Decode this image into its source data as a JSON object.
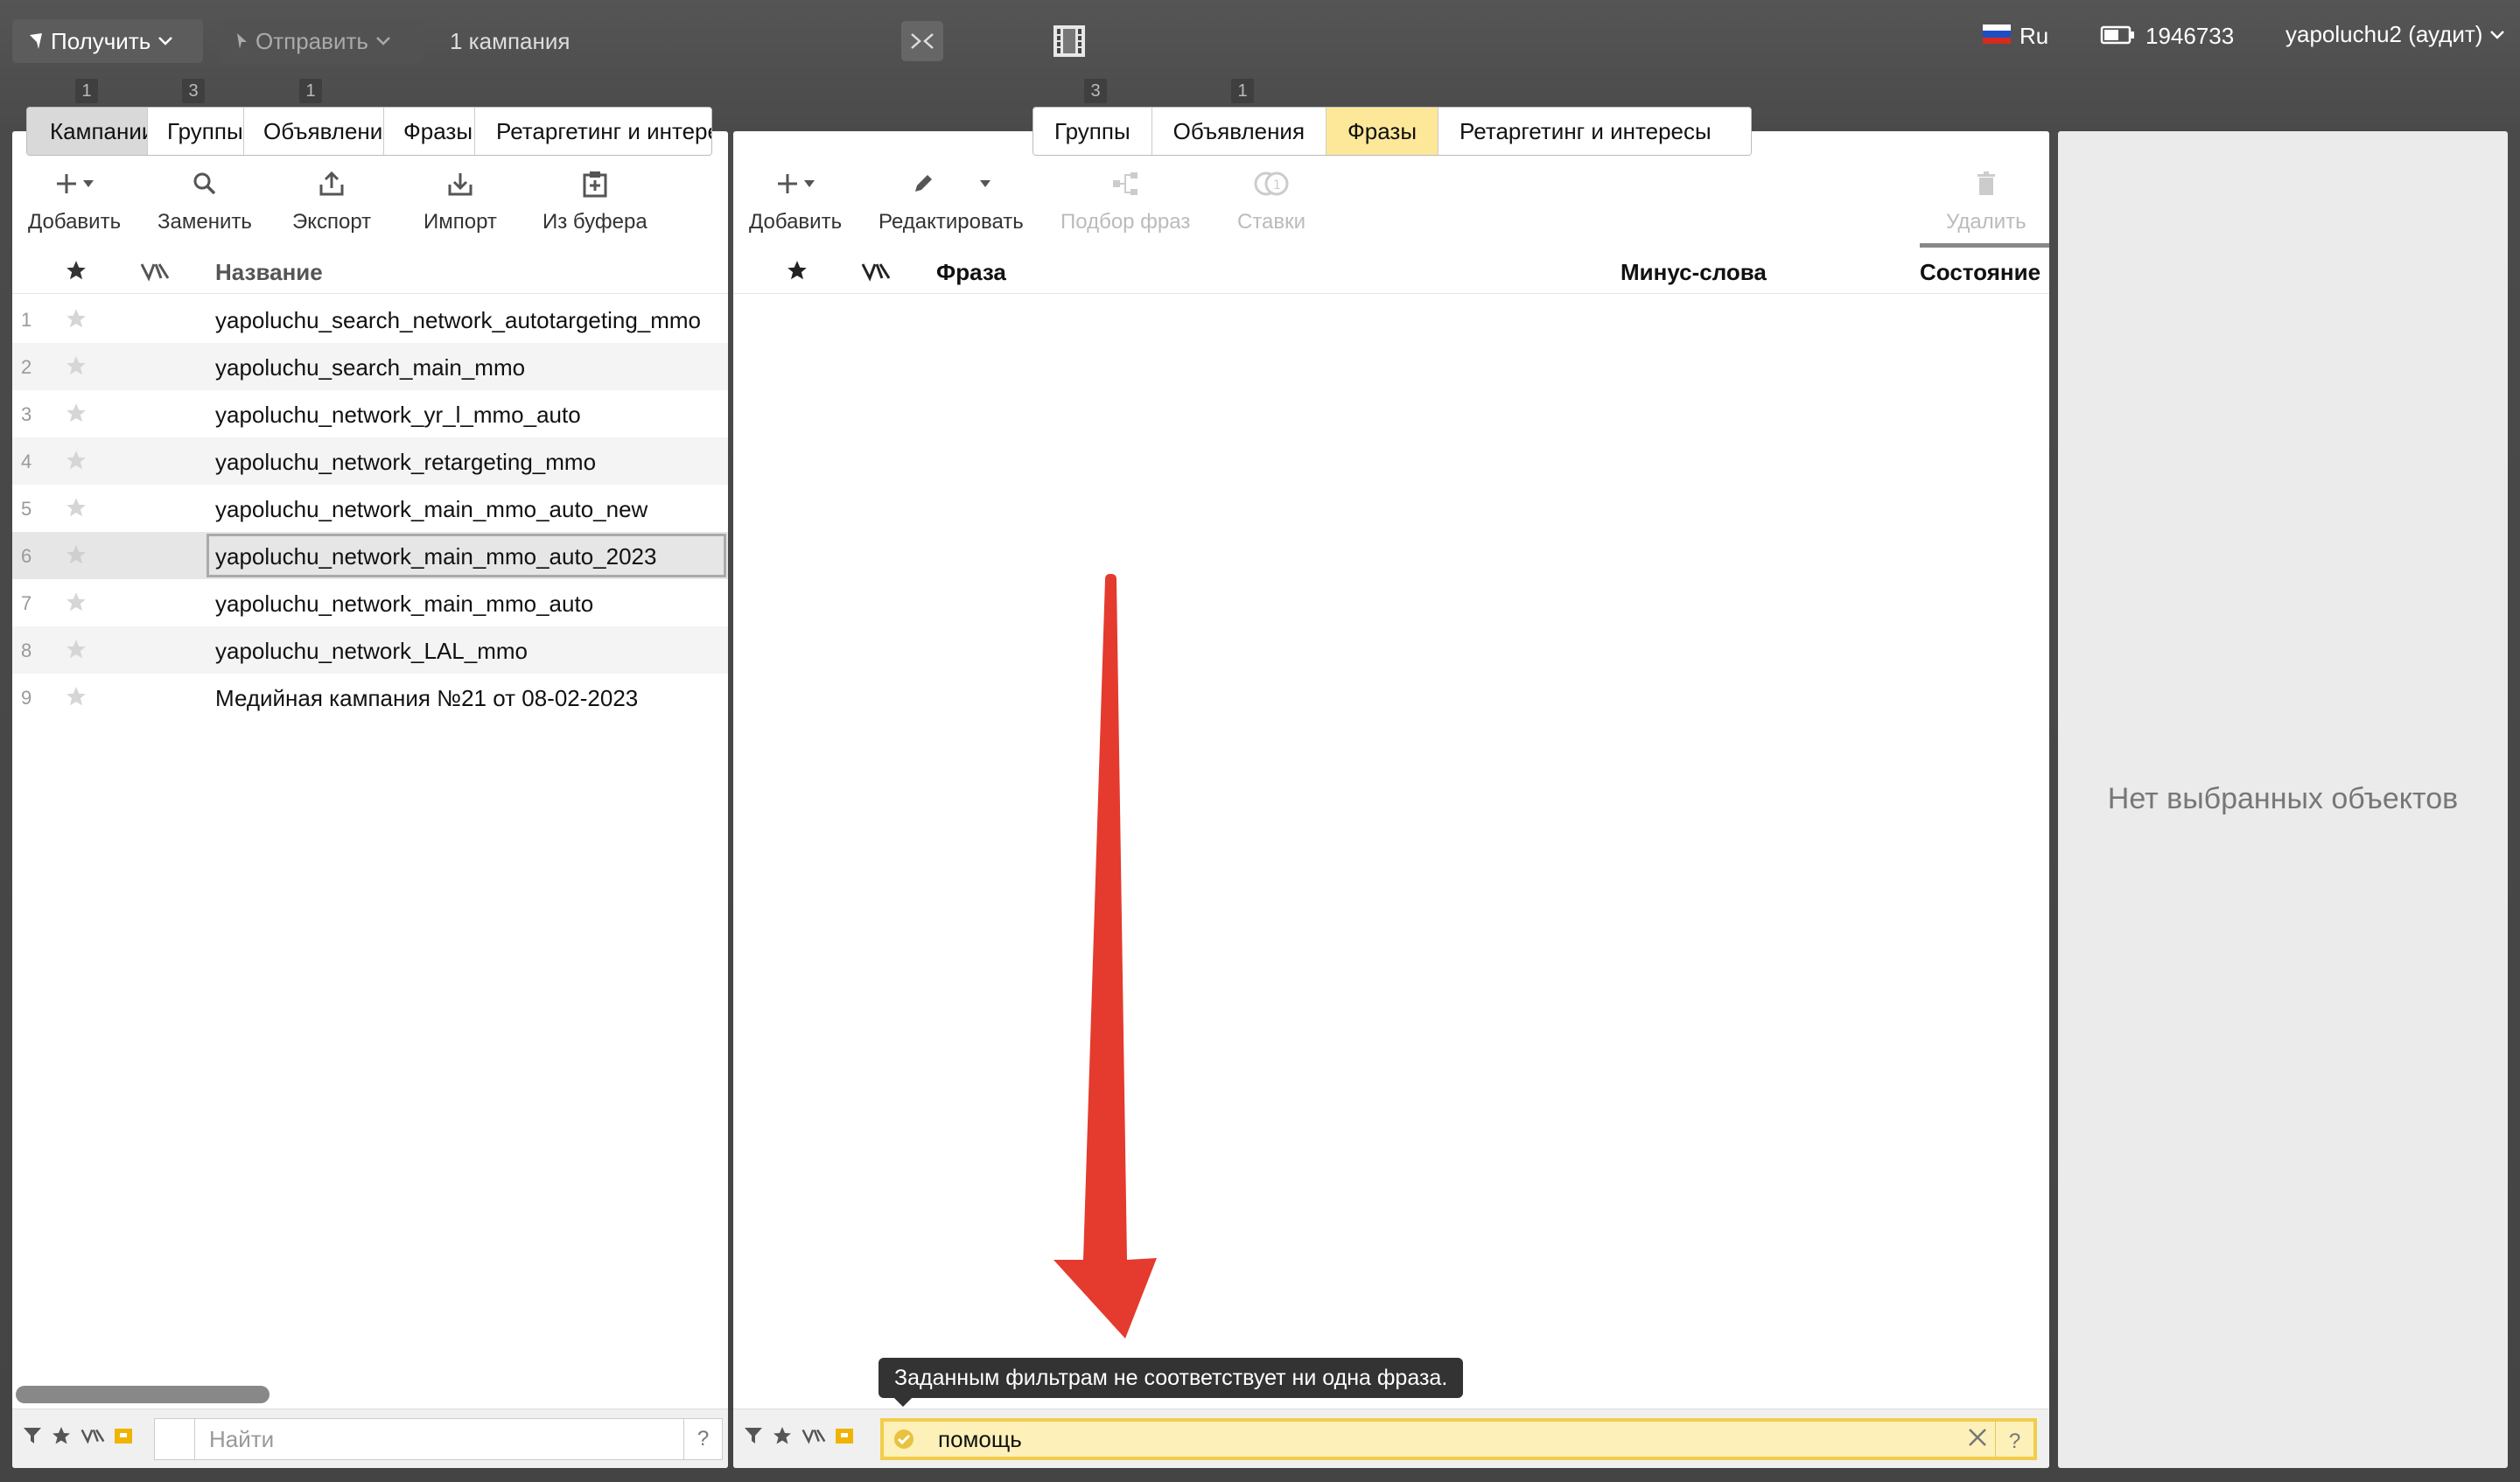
{
  "topbar": {
    "receive_label": "Получить",
    "send_label": "Отправить",
    "campaign_count": "1 кампания",
    "lang": "Ru",
    "balance": "1946733",
    "user": "yapoluchu2 (аудит)"
  },
  "left": {
    "badges": [
      "1",
      "3",
      "1"
    ],
    "tabs": [
      "Кампании",
      "Группы",
      "Объявления",
      "Фразы",
      "Ретаргетинг и интересы"
    ],
    "active_tab": "Кампании",
    "toolbar": [
      "Добавить",
      "Заменить",
      "Экспорт",
      "Импорт",
      "Из буфера"
    ],
    "column_name": "Название",
    "rows": [
      {
        "num": "1",
        "name": "yapoluchu_search_network_autotargeting_mmo"
      },
      {
        "num": "2",
        "name": "yapoluchu_search_main_mmo"
      },
      {
        "num": "3",
        "name": "yapoluchu_network_yr_l_mmo_auto"
      },
      {
        "num": "4",
        "name": "yapoluchu_network_retargeting_mmo"
      },
      {
        "num": "5",
        "name": "yapoluchu_network_main_mmo_auto_new"
      },
      {
        "num": "6",
        "name": "yapoluchu_network_main_mmo_auto_2023"
      },
      {
        "num": "7",
        "name": "yapoluchu_network_main_mmo_auto"
      },
      {
        "num": "8",
        "name": "yapoluchu_network_LAL_mmo"
      },
      {
        "num": "9",
        "name": "Медийная кампания №21 от 08-02-2023"
      }
    ],
    "selected_row": "6",
    "search_placeholder": "Найти",
    "help": "?"
  },
  "middle": {
    "badges": [
      "3",
      "1"
    ],
    "tabs": [
      "Группы",
      "Объявления",
      "Фразы",
      "Ретаргетинг и интересы"
    ],
    "active_tab": "Фразы",
    "toolbar": {
      "add": "Добавить",
      "edit": "Редактировать",
      "pick": "Подбор фраз",
      "bids": "Ставки",
      "delete": "Удалить"
    },
    "columns": {
      "phrase": "Фраза",
      "minus": "Минус-слова",
      "state": "Состояние"
    },
    "search_value": "помощь",
    "tooltip": "Заданным фильтрам не соответствует ни одна фраза.",
    "help": "?"
  },
  "right": {
    "empty_text": "Нет выбранных объектов"
  },
  "colors": {
    "active_tab_yellow": "#fde89a",
    "search_highlight": "#f2cd4c",
    "arrow": "#e53a2e"
  }
}
